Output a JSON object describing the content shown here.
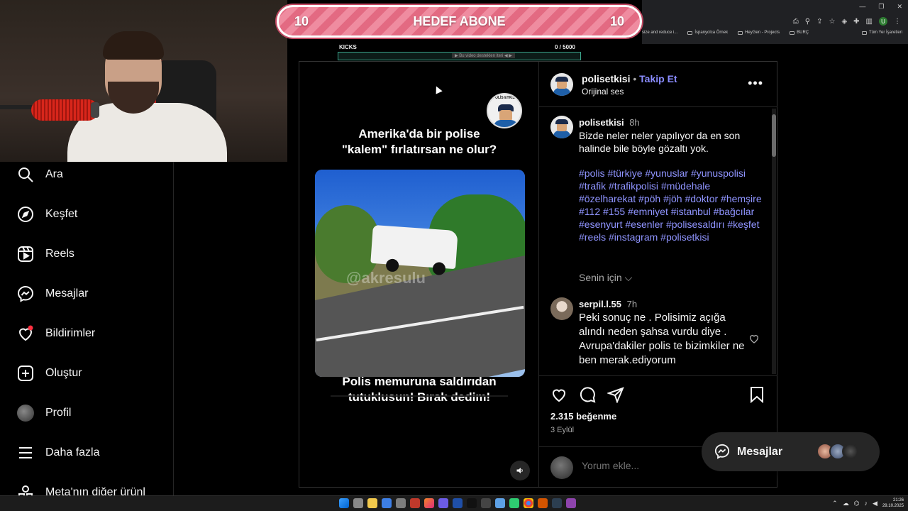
{
  "browser": {
    "bookmarks": [
      "size and reduce i...",
      "İspanyolca Örnek",
      "HeyGen - Projects",
      "BURÇ"
    ],
    "bookmarks_right": "Tüm Yer İşaretleri",
    "profile_initial": "U"
  },
  "stream_overlay": {
    "goal_left": "10",
    "goal_title": "HEDEF ABONE",
    "goal_right": "10",
    "kicks_label": "KICKS",
    "kicks_count": "0 / 5000",
    "kicks_progress": 0,
    "kicks_note": "▶ Bu video desteklen iteri ◀ ▶"
  },
  "sidebar": {
    "items": [
      {
        "label": "Ara",
        "icon": "search-icon"
      },
      {
        "label": "Keşfet",
        "icon": "compass-icon"
      },
      {
        "label": "Reels",
        "icon": "reels-icon"
      },
      {
        "label": "Mesajlar",
        "icon": "messenger-icon"
      },
      {
        "label": "Bildirimler",
        "icon": "heart-icon"
      },
      {
        "label": "Oluştur",
        "icon": "plus-square-icon"
      },
      {
        "label": "Profil",
        "icon": "avatar"
      },
      {
        "label": "Daha fazla",
        "icon": "menu-icon"
      },
      {
        "label": "Meta'nın diğer ürünl",
        "icon": "meta-icon"
      }
    ]
  },
  "video": {
    "badge_text": "POLİS ETKİSİ",
    "title_line1": "Amerika'da bir polise",
    "title_line2": "\"kalem\" fırlatırsan ne olur?",
    "watermark": "@akresulu",
    "caption_line1": "Polis memuruna saldırıdan",
    "caption_line2": "tutuklusun! Bırak dedim!"
  },
  "post": {
    "username": "polisetkisi",
    "separator": "•",
    "follow": "Takip Et",
    "audio": "Orijinal ses",
    "more": "•••",
    "caption_user": "polisetkisi",
    "caption_time": "8h",
    "caption_text": "Bizde neler neler yapılıyor da en son halinde bile böyle gözaltı yok.",
    "hashtags": "#polis #türkiye #yunuslar #yunuspolisi #trafik #trafikpolisi #müdehale #özelharekat #pöh #jöh #doktor #hemşire #112 #155 #emniyet #istanbul #bağcılar #esenyurt #esenler #polisesaldırı #keşfet #reels #instagram #polisetkisi",
    "for_you": "Senin için",
    "comment_user": "serpil.l.55",
    "comment_time": "7h",
    "comment_text": "Peki sonuç ne . Polisimiz açığa alındı neden şahsa vurdu diye . Avrupa'dakiler polis te bizimkiler ne ben merak.ediyorum",
    "likes": "2.315 beğenme",
    "date": "3 Eylül",
    "add_comment_placeholder": "Yorum ekle..."
  },
  "messages_pill": {
    "label": "Mesajlar"
  },
  "taskbar": {
    "time": "21:26",
    "date": "29.10.2025"
  },
  "colors": {
    "accent": "#8a8cff",
    "hashtag": "#8f94ff",
    "goal_pink": "#e36a82"
  }
}
